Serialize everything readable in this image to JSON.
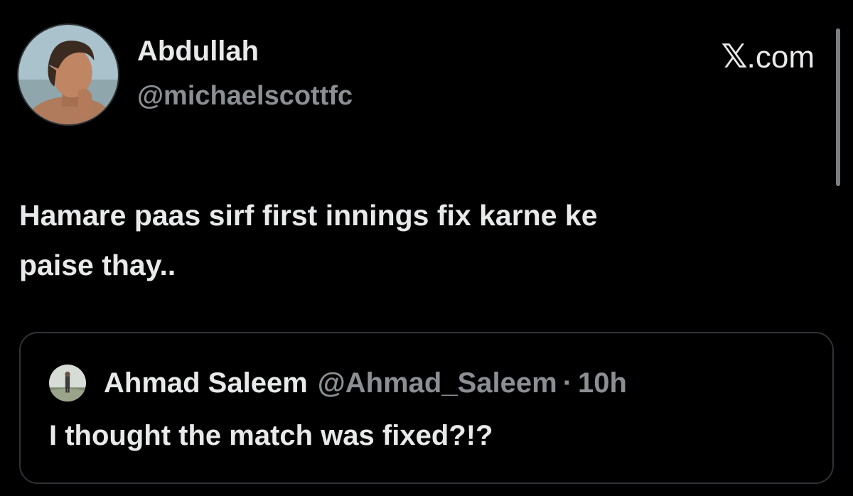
{
  "tweet": {
    "author_name": "Abdullah",
    "author_handle": "@michaelscottfc",
    "avatar_icon": "profile-photo-avatar",
    "text_line_1": "Hamare paas sirf first innings fix karne ke",
    "text_line_2": "paise thay.."
  },
  "brand": {
    "x_glyph": "𝕏",
    "suffix": ".com"
  },
  "quoted_tweet": {
    "author_name": "Ahmad Saleem",
    "author_handle": "@Ahmad_Saleem",
    "separator": "·",
    "time": "10h",
    "text": "I thought the match was fixed?!?",
    "avatar_icon": "profile-photo-avatar"
  },
  "colors": {
    "background": "#000000",
    "primary_text": "#e7e9ea",
    "secondary_text": "#8b8f93",
    "border": "#2f3336"
  }
}
